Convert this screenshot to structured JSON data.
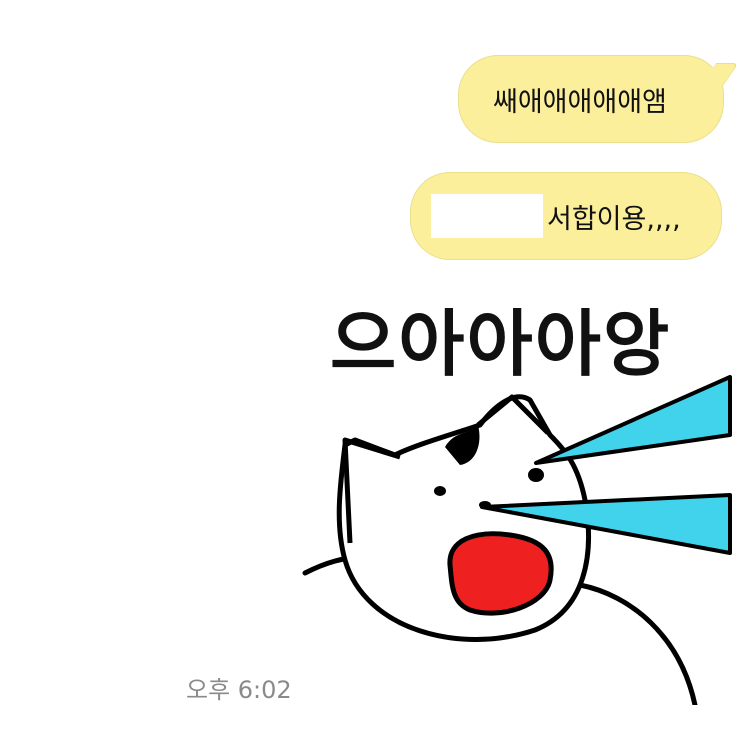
{
  "messages": [
    {
      "text": "쌔애애애애애앰"
    },
    {
      "text": "서합이용,,,,",
      "redacted_prefix": true
    }
  ],
  "sticker": {
    "caption": "으아아아앙",
    "colors": {
      "beam": "#41d2ec",
      "mouth": "#ee2020",
      "outline": "#000000"
    }
  },
  "timestamp": "오후 6:02",
  "colors": {
    "bubble": "#fcef9c",
    "background": "#ffffff"
  }
}
